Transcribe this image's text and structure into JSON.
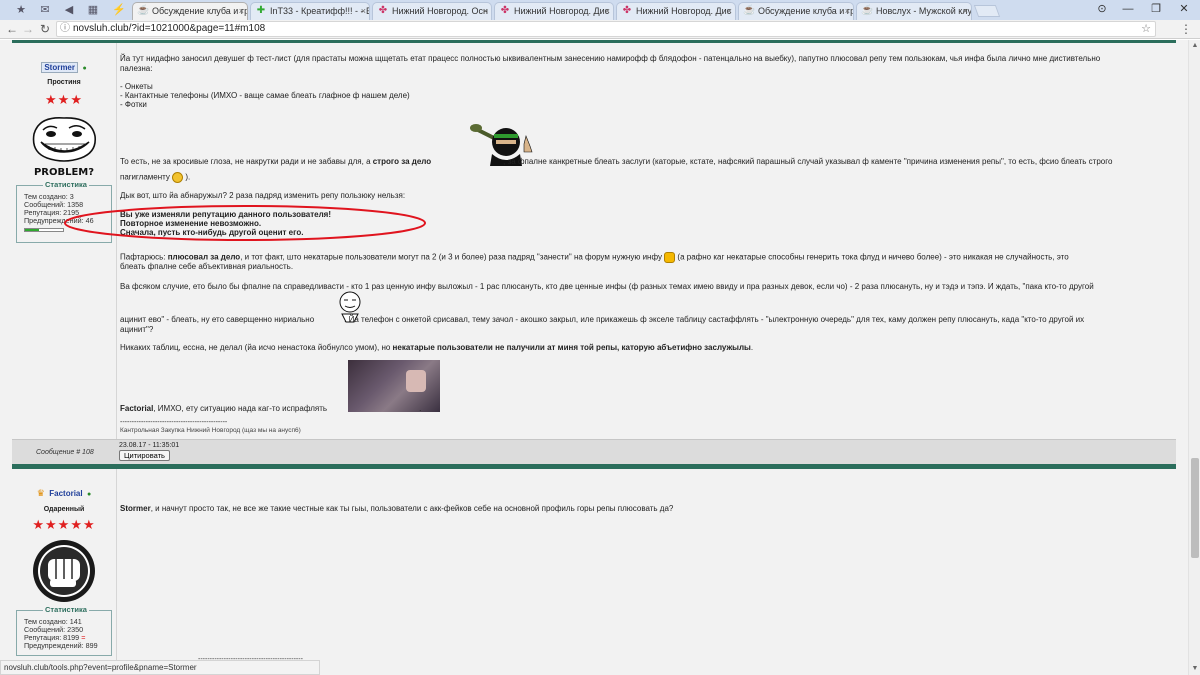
{
  "browser": {
    "tabs": [
      {
        "label": "Обсуждение клуба и гр"
      },
      {
        "label": "InT33 - Креатифф!!! - - В"
      },
      {
        "label": "Нижний Новгород. Осн"
      },
      {
        "label": "Нижний Новгород. Дис"
      },
      {
        "label": "Нижний Новгород. Дис"
      },
      {
        "label": "Обсуждение клуба и гр"
      },
      {
        "label": "Новслух - Мужской клу"
      }
    ],
    "url": "novsluh.club/?id=1021000&page=11#m108",
    "status_url": "novsluh.club/tools.php?event=profile&pname=Stormer"
  },
  "post1": {
    "author": "Stormer",
    "user_title": "Простиня",
    "avatar_caption": "PROBLEM?",
    "stats": {
      "title": "Статистика",
      "topics": "Тем создано: 3",
      "messages": "Сообщений: 1358",
      "reputation": "Репутация: 2195",
      "warnings": "Предупреждений: 46"
    },
    "text": {
      "p1a": "Йа тут нидафно заносил девушег ф тест-лист (для прастаты можна щщетать етат працесс полностью ыквивалентным занесению намирофф ф блядофон - патенцально на выебку), папутно плюсовал репу тем пользюкам, чья инфа была лично мне дистивтельно",
      "p1b": "палезна:",
      "list1": "- Онкеты",
      "list2": "- Кантактные телефоны (ИМХО - ваще самае блеать глафное ф нашем деле)",
      "list3": "- Фотки",
      "p2_pre": "То есть, не за кросивые глоза, не накрутки ради и не забавы для, а ",
      "p2_bold": "строго за дело",
      "p2_post": ", за фпалне канкретные блеать заслуги (каторые, кстате, нафсякий парашный случай указывал ф каменте \"причина изменения репы\", то есть, фсио блеать строго",
      "p2b": "пarигламенту",
      "p2c": ").",
      "p3": "Дык вот, што йа абнаружыл? 2 раза падряд изменить репу пользюку нельзя:",
      "err1": "Вы уже изменяли репутацию данного пользователя!",
      "err2": "Повторное изменение невозможно.",
      "err3": "Сначала, пусть кто-нибудь другой оценит его.",
      "p4_pre": "Пафтарюсь: ",
      "p4_bold": "плюсовал за дело",
      "p4_post": ", и тот факт, што некатарые пользователи могут па 2 (и 3 и более) раза падряд \"занести\" на форум нужную инфу",
      "p4_post2": "(а рафно каг некатарые способны генерить тока флуд и ничево более) - это никакая не случайность, это",
      "p4b": "блеать фпалне себе абъективная риальность.",
      "p5": "Ва фсяком случие, ето было бы фпалне па справедливасти - кто 1 раз ценную инфу выложыл - 1 рас плюсануть, кто две ценные инфы (ф разных темах имею ввиду и пра разных девок, если чо) - 2 раза плюсануть, ну и тэдэ и тэпэ. И ждать, \"пака кто-то другой",
      "p5b": "ацинит ево\" - блеать, ну ето саверщенно нириально",
      "p5c": ". Йа телефон с онкетой срисавал, тему зачол - акошко закрыл, иле прикажешь ф экселе таблицу састаффлять - \"ылектронную очередь\" для тех, каму должен репу плюсануть, када \"кто-то другой их",
      "p5d": "ацинит\"?",
      "p6_pre": "Никаких таблиц, ессна, не делал (йа исчо ненастока йобнулсо умом), но ",
      "p6_bold": "некатарые пользователи не палучили ат миня той репы, каторую абъетифно заслужылы",
      "p6_post": ".",
      "p7_bold": "Factorial",
      "p7_post": ", ИМХО, ету ситуацию нада каг-то испрафлять",
      "p7_end": ".",
      "sig_line": "----------------------------------------------",
      "sig_text": "Кантрольная Закупка Нижний Новгород (щаз мы на анусп6)"
    },
    "footer": {
      "post_number": "Сообщение # 108",
      "date": "23.08.17 - 11:35:01",
      "quote_label": "Цитировать"
    }
  },
  "post2": {
    "author": "Factorial",
    "user_title": "Одаренный",
    "stats": {
      "title": "Статистика",
      "topics": "Тем создано: 141",
      "messages": "Сообщений: 2350",
      "reputation": "Репутация: 8199",
      "reputation_mark": "=",
      "warnings": "Предупреждений: 899"
    },
    "text": {
      "bold": "Stormer",
      "rest": ", и начнут просто так, не все же такие честные как ты гыы, пользователи с акк-фейков себе на основной профиль горы репы плюсовать да?"
    }
  },
  "colors": {
    "accent": "#2b6e5c",
    "error_ellipse": "#e0141e",
    "star": "#e02020",
    "link": "#1f3f9a"
  }
}
